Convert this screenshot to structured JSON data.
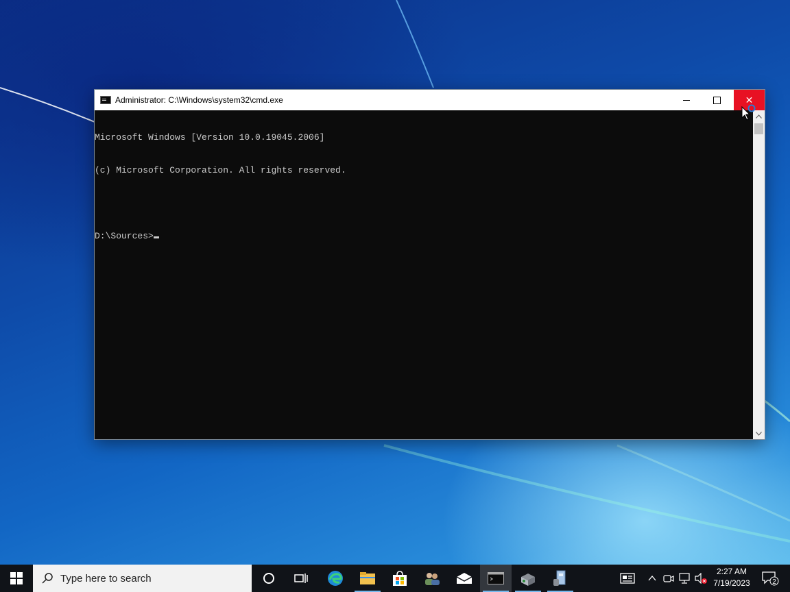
{
  "window": {
    "title": "Administrator: C:\\Windows\\system32\\cmd.exe",
    "close_glyph": "✕"
  },
  "console": {
    "lines": [
      "Microsoft Windows [Version 10.0.19045.2006]",
      "(c) Microsoft Corporation. All rights reserved.",
      "",
      "D:\\Sources>"
    ]
  },
  "scrollbar": {
    "up_glyph": "▲",
    "down_glyph": "▼"
  },
  "taskbar": {
    "search_placeholder": "Type here to search",
    "apps": [
      "cortana-icon",
      "task-view-icon",
      "edge-icon",
      "file-explorer-icon",
      "store-icon",
      "users-icon",
      "mail-icon",
      "cmd-icon",
      "installer-icon",
      "setup-icon"
    ],
    "active_app": "cmd-icon",
    "accent": "#76b9ed"
  },
  "tray": {
    "time": "2:27 AM",
    "date": "7/19/2023",
    "notification_count": "2"
  },
  "colors": {
    "close_button": "#e81123",
    "console_bg": "#0c0c0c",
    "console_text": "#cccccc",
    "taskbar_bg": "#101318"
  }
}
